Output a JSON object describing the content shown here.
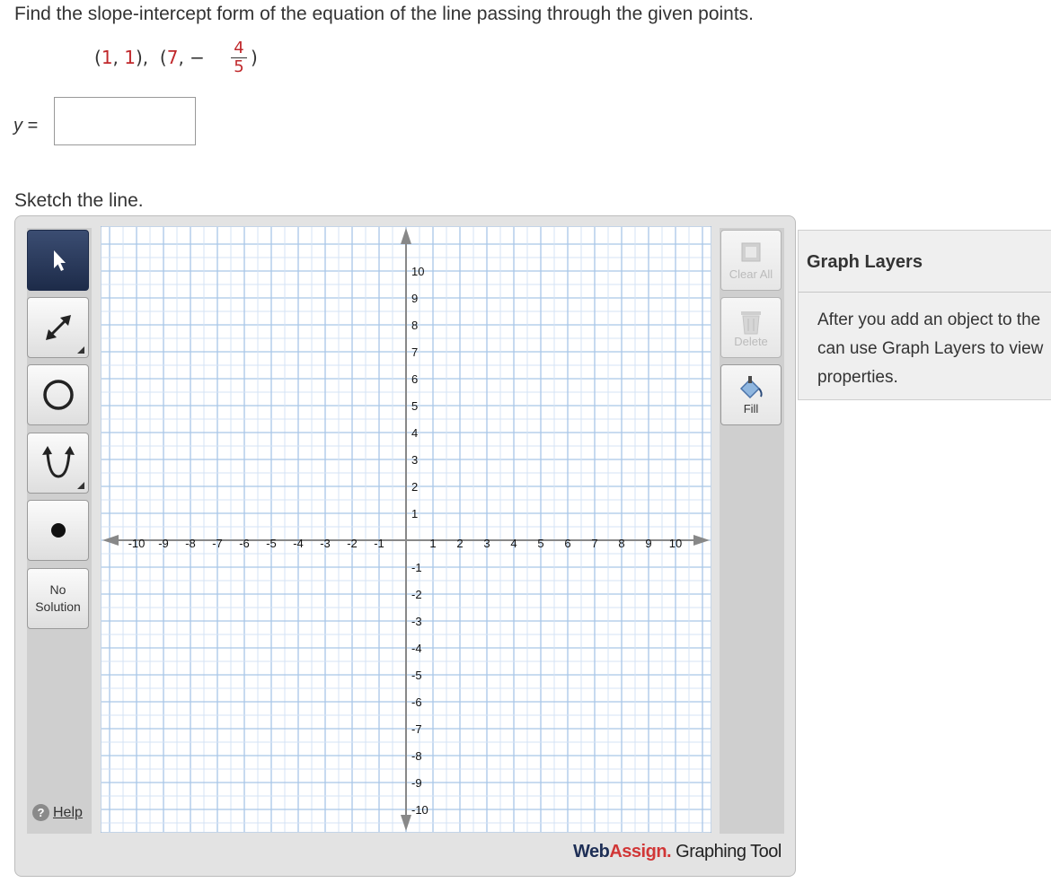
{
  "question": {
    "text": "Find the slope-intercept form of the equation of the line passing through the given points.",
    "point1": "(1, 1),",
    "point1_x": "1",
    "point1_y": "1",
    "point2_prefix": "(7, −",
    "point2_x": "7",
    "fraction_num": "4",
    "fraction_den": "5",
    "point2_suffix": ")"
  },
  "answer": {
    "label_var": "y",
    "label_eq": "=",
    "value": ""
  },
  "sketch_label": "Sketch the line.",
  "toolbar": {
    "tools": [
      {
        "name": "pointer-tool",
        "icon": "arrow-cursor-icon",
        "active": true
      },
      {
        "name": "line-tool",
        "icon": "double-arrow-line-icon"
      },
      {
        "name": "circle-tool",
        "icon": "circle-icon"
      },
      {
        "name": "parabola-tool",
        "icon": "parabola-icon"
      },
      {
        "name": "point-tool",
        "icon": "dot-icon"
      }
    ],
    "no_solution_line1": "No",
    "no_solution_line2": "Solution",
    "help_label": "Help"
  },
  "graph": {
    "x_min": -10,
    "x_max": 10,
    "y_min": -10,
    "y_max": 10,
    "x_ticks": [
      "-10",
      "-9",
      "-8",
      "-7",
      "-6",
      "-5",
      "-4",
      "-3",
      "-2",
      "-1",
      "1",
      "2",
      "3",
      "4",
      "5",
      "6",
      "7",
      "8",
      "9",
      "10"
    ],
    "y_ticks": [
      "10",
      "9",
      "8",
      "7",
      "6",
      "5",
      "4",
      "3",
      "2",
      "1",
      "-1",
      "-2",
      "-3",
      "-4",
      "-5",
      "-6",
      "-7",
      "-8",
      "-9",
      "-10"
    ],
    "grid_color": "#a9c6e8",
    "axis_color": "#888888"
  },
  "actions": {
    "clear_all_label": "Clear All",
    "delete_label": "Delete",
    "fill_label": "Fill"
  },
  "brand": {
    "web": "Web",
    "assign": "Assign.",
    "graphing_tool": "Graphing Tool"
  },
  "layers": {
    "title": "Graph Layers",
    "description_line1": "After you add an object to the",
    "description_line2": "can use Graph Layers to view",
    "description_line3": "properties."
  }
}
